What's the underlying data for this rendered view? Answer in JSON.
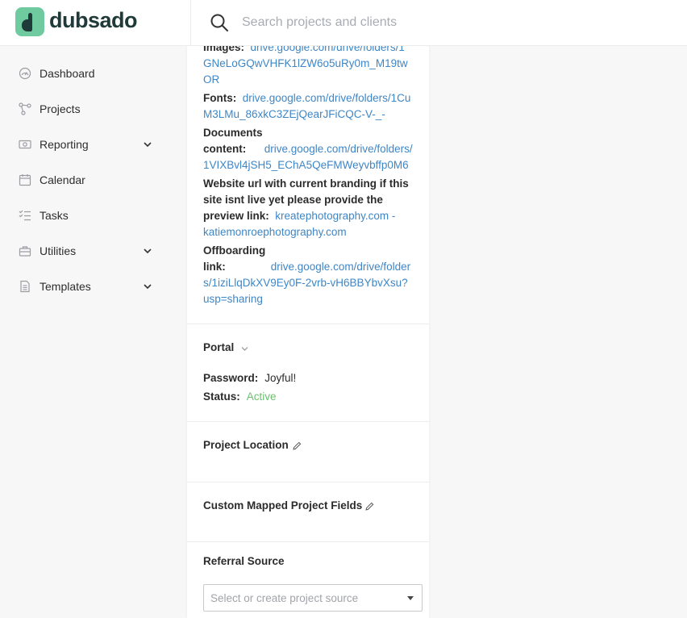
{
  "header": {
    "brand": "dubsado",
    "search_placeholder": "Search projects and clients"
  },
  "sidebar": {
    "items": [
      {
        "label": "Dashboard",
        "icon": "gauge-icon",
        "has_chevron": false
      },
      {
        "label": "Projects",
        "icon": "projects-icon",
        "has_chevron": false
      },
      {
        "label": "Reporting",
        "icon": "money-icon",
        "has_chevron": true
      },
      {
        "label": "Calendar",
        "icon": "calendar-icon",
        "has_chevron": false
      },
      {
        "label": "Tasks",
        "icon": "tasks-icon",
        "has_chevron": false
      },
      {
        "label": "Utilities",
        "icon": "toolbox-icon",
        "has_chevron": true
      },
      {
        "label": "Templates",
        "icon": "document-icon",
        "has_chevron": true
      }
    ]
  },
  "project_fields": {
    "images_label": "Images:",
    "images_value": "drive.google.com/drive/folders/1GNeLoGQwVHFK1lZW6o5uRy0m_M19twOR",
    "fonts_label": "Fonts:",
    "fonts_value": "drive.google.com/drive/folders/1CuM3LMu_86xkC3ZEjQearJFiCQC-V-_-",
    "documents_label": "Documents content:",
    "documents_value": "drive.google.com/drive/folders/1VIXBvl4jSH5_EChA5QeFMWeyvbffp0M6",
    "website_label": "Website url with current branding if this site isnt live yet please provide the preview link:",
    "website_value": "kreatephotography.com - katiemonroephotography.com",
    "offboarding_label": "Offboarding link:",
    "offboarding_value": "drive.google.com/drive/folders/1iziLlqDkXV9Ey0F-2vrb-vH6BBYbvXsu?usp=sharing"
  },
  "portal": {
    "title": "Portal",
    "password_label": "Password:",
    "password_value": "Joyful!",
    "status_label": "Status:",
    "status_value": "Active"
  },
  "project_location": {
    "title": "Project Location"
  },
  "custom_fields": {
    "title": "Custom Mapped Project Fields"
  },
  "referral": {
    "title": "Referral Source",
    "placeholder": "Select or create project source"
  },
  "colors": {
    "brand_green": "#6fcb9f",
    "brand_dark": "#1f3a38",
    "link_blue": "#3e86c6",
    "status_active": "#6cc16f"
  }
}
